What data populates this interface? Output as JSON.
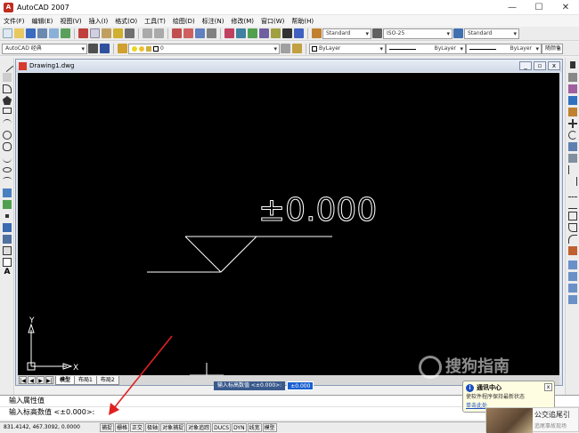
{
  "window": {
    "title": "AutoCAD 2007",
    "min": "—",
    "max": "☐",
    "close": "✕"
  },
  "menu": [
    "文件(F)",
    "编辑(E)",
    "视图(V)",
    "插入(I)",
    "格式(O)",
    "工具(T)",
    "绘图(D)",
    "标注(N)",
    "修改(M)",
    "窗口(W)",
    "帮助(H)"
  ],
  "toolbar": {
    "text_style": "Standard",
    "dim_style": "ISO-25",
    "table_style": "Standard",
    "workspace": "AutoCAD 经典",
    "layer": "0",
    "color": "ByLayer",
    "linetype": "ByLayer",
    "lineweight": "ByLayer",
    "plotstyle": "随颜色"
  },
  "document": {
    "title": "Drawing1.dwg",
    "min": "_",
    "restore": "▫",
    "close": "x",
    "drawing_text": "±0.000",
    "ucs_x": "X",
    "ucs_y": "Y"
  },
  "tabs": [
    "模型",
    "布局1",
    "布局2"
  ],
  "nav": [
    "|◀",
    "◀",
    "▶",
    "▶|"
  ],
  "dynamic_input": {
    "label": "输入标高数值 <±0.000>:",
    "value": "±0.000"
  },
  "command": {
    "line1": "输入属性值",
    "line2": "输入标高数值 <±0.000>:"
  },
  "status": {
    "coords": "831.4142, 467.3092, 0.0000",
    "buttons": [
      "捕捉",
      "栅格",
      "正交",
      "极轴",
      "对象捕捉",
      "对象追踪",
      "DUCS",
      "DYN",
      "线宽",
      "模型"
    ]
  },
  "notification": {
    "title": "通讯中心",
    "close": "x",
    "body": "使软件程序保持最新状态",
    "link": "单击此处"
  },
  "ad": {
    "text": "公交追尾引",
    "sub": "追尾事故现场"
  },
  "watermark": "搜狗指南",
  "colors": {
    "accent": "#1a5fd0",
    "canvas": "#000000",
    "arrow": "#e02020"
  }
}
